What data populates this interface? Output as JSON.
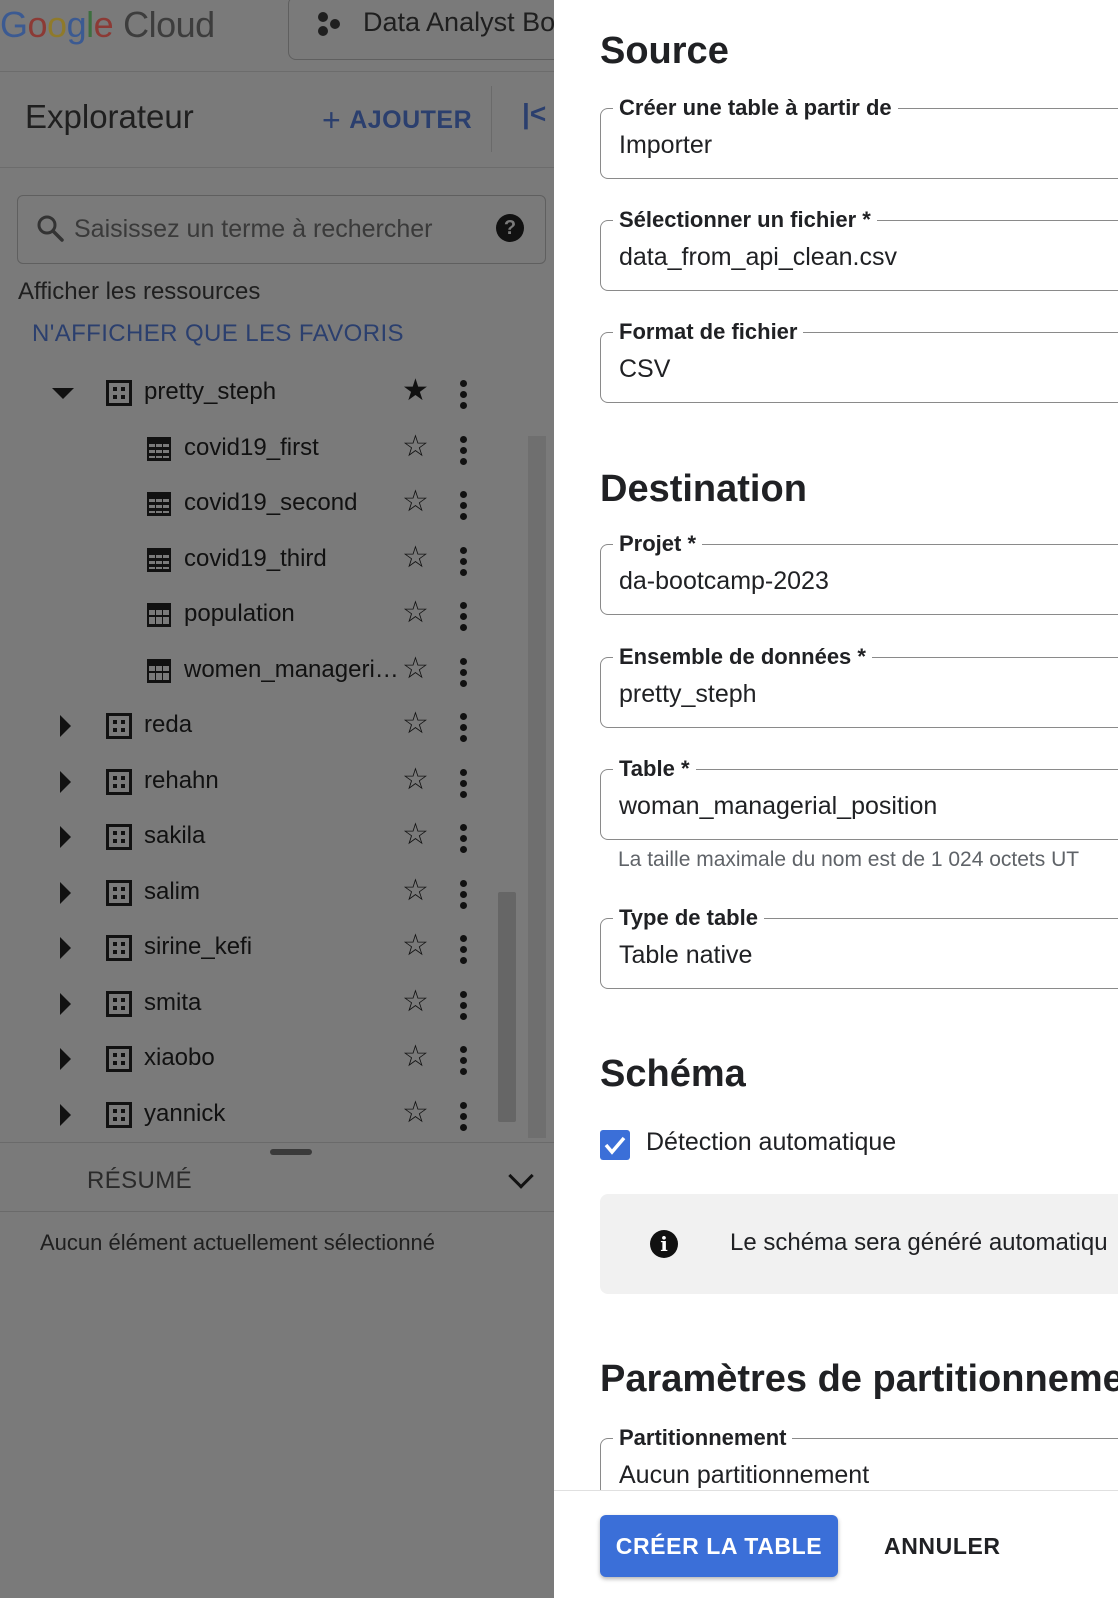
{
  "header": {
    "logo": {
      "g": "G",
      "o1": "o",
      "o2": "o",
      "g2": "g",
      "l": "l",
      "e": "e",
      "cloud": "Cloud"
    },
    "project_tab": "Data Analyst Bo"
  },
  "explorer": {
    "title": "Explorateur",
    "add_label": "AJOUTER",
    "search_placeholder": "Saisissez un terme à rechercher",
    "show_resources": "Afficher les ressources",
    "favorites_link": "N'AFFICHER QUE LES FAVORIS",
    "tree": [
      {
        "label": "pretty_steph",
        "type": "dataset",
        "expanded": true,
        "starred": true,
        "depth": 0
      },
      {
        "label": "covid19_first",
        "type": "external-table",
        "starred": false,
        "depth": 1
      },
      {
        "label": "covid19_second",
        "type": "external-table",
        "starred": false,
        "depth": 1
      },
      {
        "label": "covid19_third",
        "type": "external-table",
        "starred": false,
        "depth": 1
      },
      {
        "label": "population",
        "type": "table",
        "starred": false,
        "depth": 1
      },
      {
        "label": "women_manageri…",
        "type": "table",
        "starred": false,
        "depth": 1
      },
      {
        "label": "reda",
        "type": "dataset",
        "expanded": false,
        "starred": false,
        "depth": 0
      },
      {
        "label": "rehahn",
        "type": "dataset",
        "expanded": false,
        "starred": false,
        "depth": 0
      },
      {
        "label": "sakila",
        "type": "dataset",
        "expanded": false,
        "starred": false,
        "depth": 0
      },
      {
        "label": "salim",
        "type": "dataset",
        "expanded": false,
        "starred": false,
        "depth": 0
      },
      {
        "label": "sirine_kefi",
        "type": "dataset",
        "expanded": false,
        "starred": false,
        "depth": 0
      },
      {
        "label": "smita",
        "type": "dataset",
        "expanded": false,
        "starred": false,
        "depth": 0
      },
      {
        "label": "xiaobo",
        "type": "dataset",
        "expanded": false,
        "starred": false,
        "depth": 0
      },
      {
        "label": "yannick",
        "type": "dataset",
        "expanded": false,
        "starred": false,
        "depth": 0
      }
    ],
    "resume_label": "RÉSUMÉ",
    "empty_message": "Aucun élément actuellement sélectionné"
  },
  "panel": {
    "source": {
      "title": "Source",
      "create_from": {
        "label": "Créer une table à partir de",
        "value": "Importer"
      },
      "file": {
        "label": "Sélectionner un fichier *",
        "value": "data_from_api_clean.csv"
      },
      "format": {
        "label": "Format de fichier",
        "value": "CSV"
      }
    },
    "destination": {
      "title": "Destination",
      "project": {
        "label": "Projet *",
        "value": "da-bootcamp-2023"
      },
      "dataset": {
        "label": "Ensemble de données *",
        "value": "pretty_steph"
      },
      "table": {
        "label": "Table *",
        "value": "woman_managerial_position"
      },
      "table_hint": "La taille maximale du nom est de 1 024 octets UT",
      "table_type": {
        "label": "Type de table",
        "value": "Table native"
      }
    },
    "schema": {
      "title": "Schéma",
      "auto_detect_label": "Détection automatique",
      "auto_detect_checked": true,
      "info_text": "Le schéma sera généré automatiqu"
    },
    "partition": {
      "title": "Paramètres de partitionnemer",
      "field": {
        "label": "Partitionnement",
        "value": "Aucun partitionnement"
      }
    },
    "footer": {
      "create_button": "CRÉER LA TABLE",
      "cancel_button": "ANNULER"
    }
  },
  "colors": {
    "accent": "#3b6fd8",
    "overlay": "#7a7a7a",
    "link_dimmed": "#2b3f6e"
  }
}
